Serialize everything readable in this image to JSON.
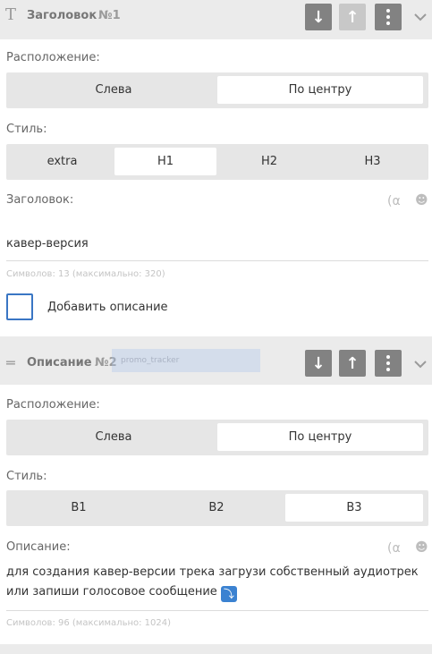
{
  "block1": {
    "title": "Заголовок",
    "number": "№1",
    "type_icon": "T",
    "buttons": {
      "down_icon": "arrow-down-icon",
      "up_icon": "arrow-up-icon",
      "menu_icon": "kebab-menu-icon",
      "collapse_icon": "chevron-down-icon"
    },
    "placement_label": "Расположение:",
    "placement_options": [
      "Слева",
      "По центру"
    ],
    "placement_selected": "По центру",
    "style_label": "Стиль:",
    "style_options": [
      "extra",
      "H1",
      "H2",
      "H3"
    ],
    "style_selected": "H1",
    "field_label": "Заголовок:",
    "field_icons": [
      "(α",
      "☻"
    ],
    "field_value": "кавер-версия",
    "char_count": "Символов: 13 (максимально: 320)",
    "add_description_label": "Добавить описание",
    "add_description_checked": false
  },
  "drag_ghost": "promo_tracker",
  "block2": {
    "title": "Описание",
    "number": "№2",
    "type_icon": "═",
    "placement_label": "Расположение:",
    "placement_options": [
      "Слева",
      "По центру"
    ],
    "placement_selected": "По центру",
    "style_label": "Стиль:",
    "style_options": [
      "B1",
      "B2",
      "B3"
    ],
    "style_selected": "B3",
    "field_label": "Описание:",
    "field_icons": [
      "(α",
      "☻"
    ],
    "field_value": "для создания кавер-версии трека загрузи собственный аудиотрек или запиши голосовое сообщение",
    "field_emoji": "⤵",
    "char_count": "Символов: 96 (максимально: 1024)"
  },
  "colors": {
    "checkbox_border": "#3a76c4",
    "header_bg": "#ebebeb",
    "segment_bg": "#e6e6e6",
    "button_dark": "#828282",
    "button_disabled": "#c8c8c8"
  }
}
